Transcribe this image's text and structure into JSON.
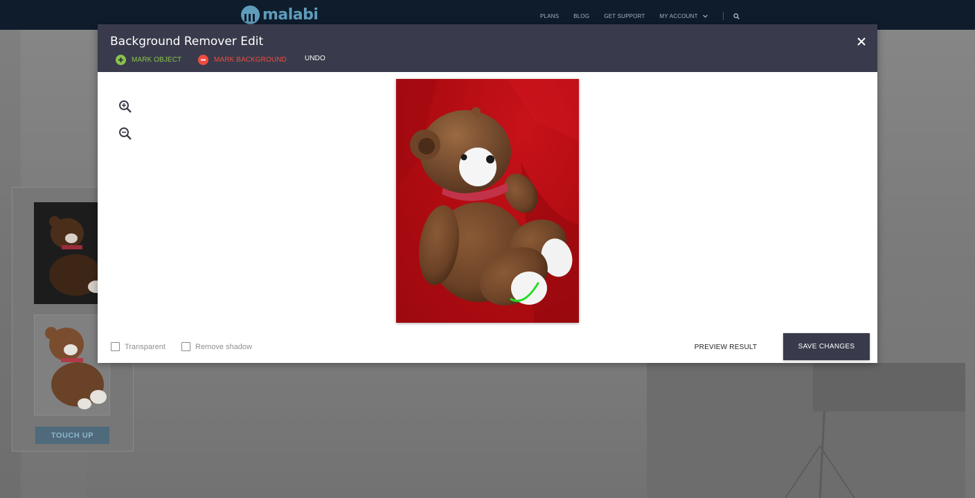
{
  "site": {
    "logo_text": "malabi",
    "nav": {
      "plans": "PLANS",
      "blog": "BLOG",
      "get_support": "GET SUPPORT",
      "my_account": "MY ACCOUNT"
    },
    "touch_up_label": "TOUCH UP"
  },
  "modal": {
    "title": "Background Remover Edit",
    "tools": {
      "mark_object": "MARK OBJECT",
      "mark_background": "MARK BACKGROUND",
      "undo": "UNDO"
    },
    "options": {
      "transparent": {
        "label": "Transparent",
        "checked": false
      },
      "remove_shadow": {
        "label": "Remove shadow",
        "checked": false
      }
    },
    "preview_label": "PREVIEW RESULT",
    "save_label": "SAVE CHANGES"
  },
  "colors": {
    "header_bg": "#393b4c",
    "mark_object": "#8ac34a",
    "mark_background": "#ef4b3f",
    "site_nav_bg": "#0e1c2c",
    "canvas_background": "#b20c12",
    "stroke_green": "#22dd22"
  },
  "icons": {
    "close": "close-icon",
    "zoom_in": "zoom-in-icon",
    "zoom_out": "zoom-out-icon",
    "mark_object": "plus-circle-icon",
    "mark_background": "minus-circle-icon",
    "search": "search-icon",
    "account_dropdown": "chevron-down-icon"
  }
}
